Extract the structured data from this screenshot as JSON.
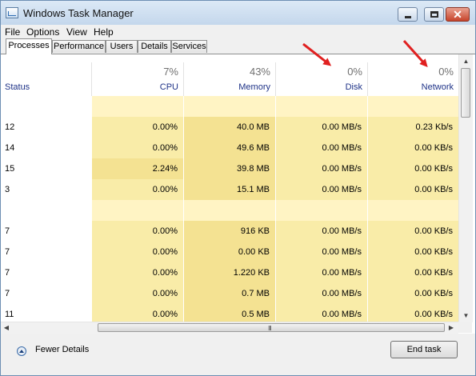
{
  "window": {
    "title": "Windows Task Manager",
    "close_glyph": "✕"
  },
  "menu": [
    "File",
    "Options",
    "View",
    "Help"
  ],
  "tabs": [
    "Processes",
    "Performance",
    "Users",
    "Details",
    "Services"
  ],
  "columns": {
    "status": {
      "label": "Status"
    },
    "cpu": {
      "pct": "7%",
      "label": "CPU"
    },
    "memory": {
      "pct": "43%",
      "label": "Memory"
    },
    "disk": {
      "pct": "0%",
      "label": "Disk"
    },
    "network": {
      "pct": "0%",
      "label": "Network"
    }
  },
  "rows": [
    {
      "status": "12",
      "cpu": "0.00%",
      "memory": "40.0 MB",
      "disk": "0.00 MB/s",
      "network": "0.23 Kb/s"
    },
    {
      "status": "14",
      "cpu": "0.00%",
      "memory": "49.6 MB",
      "disk": "0.00 MB/s",
      "network": "0.00 KB/s"
    },
    {
      "status": "15",
      "cpu": "2.24%",
      "memory": "39.8 MB",
      "disk": "0.00 MB/s",
      "network": "0.00 KB/s"
    },
    {
      "status": "3",
      "cpu": "0.00%",
      "memory": "15.1 MB",
      "disk": "0.00 MB/s",
      "network": "0.00 KB/s"
    },
    {
      "status": "7",
      "cpu": "0.00%",
      "memory": "916 KB",
      "disk": "0.00 MB/s",
      "network": "0.00 KB/s"
    },
    {
      "status": "7",
      "cpu": "0.00%",
      "memory": "0.00 KB",
      "disk": "0.00 MB/s",
      "network": "0.00 KB/s"
    },
    {
      "status": "7",
      "cpu": "0.00%",
      "memory": "1.220 KB",
      "disk": "0.00 MB/s",
      "network": "0.00 KB/s"
    },
    {
      "status": "7",
      "cpu": "0.00%",
      "memory": "0.7 MB",
      "disk": "0.00 MB/s",
      "network": "0.00 KB/s"
    },
    {
      "status": "11",
      "cpu": "0.00%",
      "memory": "0.5 MB",
      "disk": "0.00 MB/s",
      "network": "0.00 KB/s"
    }
  ],
  "scrollbar": {
    "grip": "III",
    "up": "▲",
    "down": "▼",
    "left": "◀",
    "right": "▶"
  },
  "footer": {
    "fewer_details": "Fewer Details",
    "end_task": "End task"
  },
  "colors": {
    "heat_light": "#fff4c4",
    "heat_mid": "#f9eca8",
    "heat_dark": "#f4e292",
    "annotation_arrow": "#e02020"
  }
}
